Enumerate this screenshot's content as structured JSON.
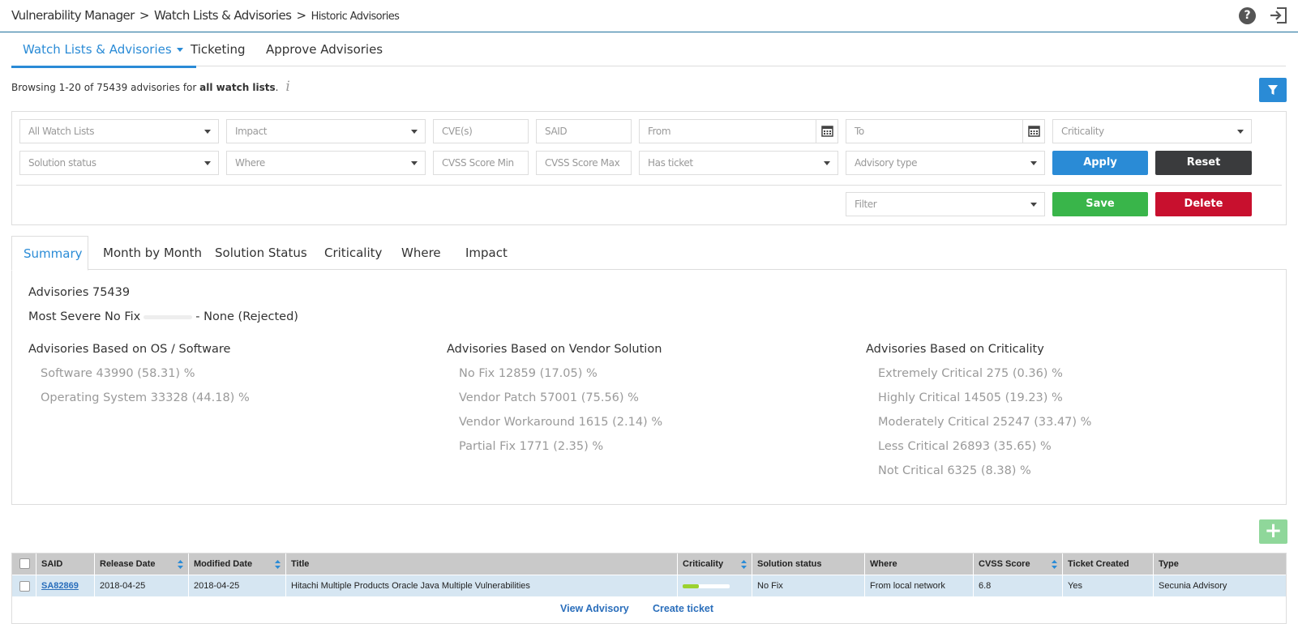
{
  "header": {
    "crumbs": [
      "Vulnerability Manager",
      "Watch Lists & Advisories",
      "Historic Advisories"
    ],
    "separator": ">"
  },
  "nav": {
    "tabs": [
      "Watch Lists & Advisories",
      "Ticketing",
      "Approve Advisories"
    ]
  },
  "browsing": {
    "prefix": "Browsing 1-20 of 75439 advisories for",
    "scope": "all watch lists",
    "suffix": "."
  },
  "filters": {
    "row1": [
      "All Watch Lists",
      "Impact",
      "CVE(s)",
      "SAID",
      "From",
      "To",
      "Criticality"
    ],
    "row2": [
      "Solution status",
      "Where",
      "CVSS Score Min",
      "CVSS Score Max",
      "Has ticket",
      "Advisory type"
    ],
    "saved_filter": "Filter",
    "apply_label": "Apply",
    "reset_label": "Reset",
    "save_label": "Save",
    "delete_label": "Delete"
  },
  "summary_tabs": [
    "Summary",
    "Month by Month",
    "Solution Status",
    "Criticality",
    "Where",
    "Impact"
  ],
  "summary": {
    "advisories": "Advisories 75439",
    "most_severe_label": "Most Severe No Fix",
    "most_severe_value": "- None (Rejected)",
    "os_software": {
      "heading": "Advisories Based on OS / Software",
      "items": [
        "Software  43990 (58.31) %",
        "Operating System  33328 (44.18) %"
      ]
    },
    "vendor_solution": {
      "heading": "Advisories Based on Vendor Solution",
      "items": [
        "No Fix  12859 (17.05) %",
        "Vendor Patch  57001 (75.56) %",
        "Vendor Workaround  1615 (2.14) %",
        "Partial Fix  1771 (2.35) %"
      ]
    },
    "criticality": {
      "heading": "Advisories Based on Criticality",
      "items": [
        "Extremely Critical  275 (0.36) %",
        "Highly Critical  14505 (19.23) %",
        "Moderately Critical  25247 (33.47) %",
        "Less Critical  26893 (35.65) %",
        "Not Critical  6325 (8.38) %"
      ]
    }
  },
  "table": {
    "columns": [
      "SAID",
      "Release Date",
      "Modified Date",
      "Title",
      "Criticality",
      "Solution status",
      "Where",
      "CVSS Score",
      "Ticket Created",
      "Type"
    ],
    "rows": [
      {
        "said": "SA82869",
        "release_date": "2018-04-25",
        "modified_date": "2018-04-25",
        "title": "Hitachi Multiple Products Oracle Java Multiple Vulnerabilities",
        "criticality_level": 0.35,
        "solution_status": "No Fix",
        "where": "From local network",
        "cvss": "6.8",
        "ticket": "Yes",
        "type": "Secunia Advisory"
      }
    ],
    "row_actions": [
      "View Advisory",
      "Create ticket"
    ]
  },
  "colors": {
    "accent": "#2a8bd6",
    "apply": "#2a8bd6",
    "reset": "#3a3b3d",
    "save": "#39b54a",
    "delete": "#c8102e",
    "criticality_fill": "#9bd230"
  }
}
